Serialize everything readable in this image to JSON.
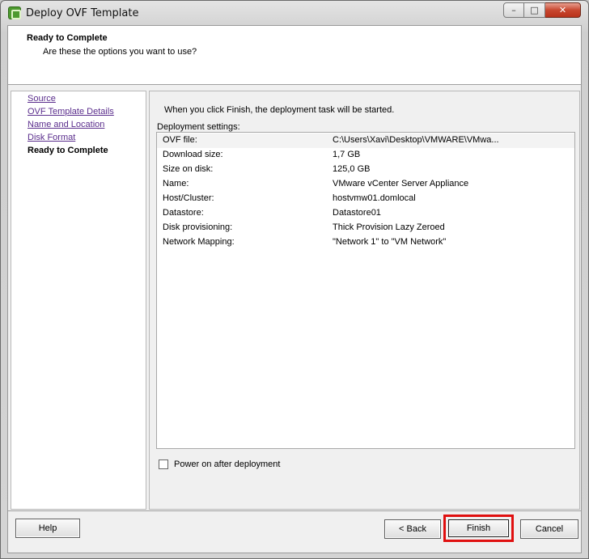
{
  "window": {
    "title": "Deploy OVF Template",
    "caption": {
      "minimize": "–",
      "maximize": "□",
      "close": "✕"
    }
  },
  "header": {
    "title": "Ready to Complete",
    "subtitle": "Are these the options you want to use?"
  },
  "nav": {
    "items": [
      {
        "label": "Source",
        "active": false
      },
      {
        "label": "OVF Template Details",
        "active": false
      },
      {
        "label": "Name and Location",
        "active": false
      },
      {
        "label": "Disk Format",
        "active": false
      },
      {
        "label": "Ready to Complete",
        "active": true
      }
    ]
  },
  "content": {
    "info": "When you click Finish, the deployment task will be started.",
    "settings_label": "Deployment settings:",
    "settings": [
      {
        "key": "OVF file:",
        "value": "C:\\Users\\Xavi\\Desktop\\VMWARE\\VMwa..."
      },
      {
        "key": "Download size:",
        "value": "1,7 GB"
      },
      {
        "key": "Size on disk:",
        "value": "125,0 GB"
      },
      {
        "key": "Name:",
        "value": "VMware vCenter Server Appliance"
      },
      {
        "key": "Host/Cluster:",
        "value": "hostvmw01.domlocal"
      },
      {
        "key": "Datastore:",
        "value": "Datastore01"
      },
      {
        "key": "Disk provisioning:",
        "value": "Thick Provision Lazy Zeroed"
      },
      {
        "key": "Network Mapping:",
        "value": "\"Network 1\" to \"VM Network\""
      }
    ],
    "power_on_label": "Power on after deployment",
    "power_on_checked": false
  },
  "buttons": {
    "help": "Help",
    "back": "< Back",
    "finish": "Finish",
    "cancel": "Cancel"
  },
  "colors": {
    "highlight": "#e01010",
    "link": "#5a2d8c"
  }
}
